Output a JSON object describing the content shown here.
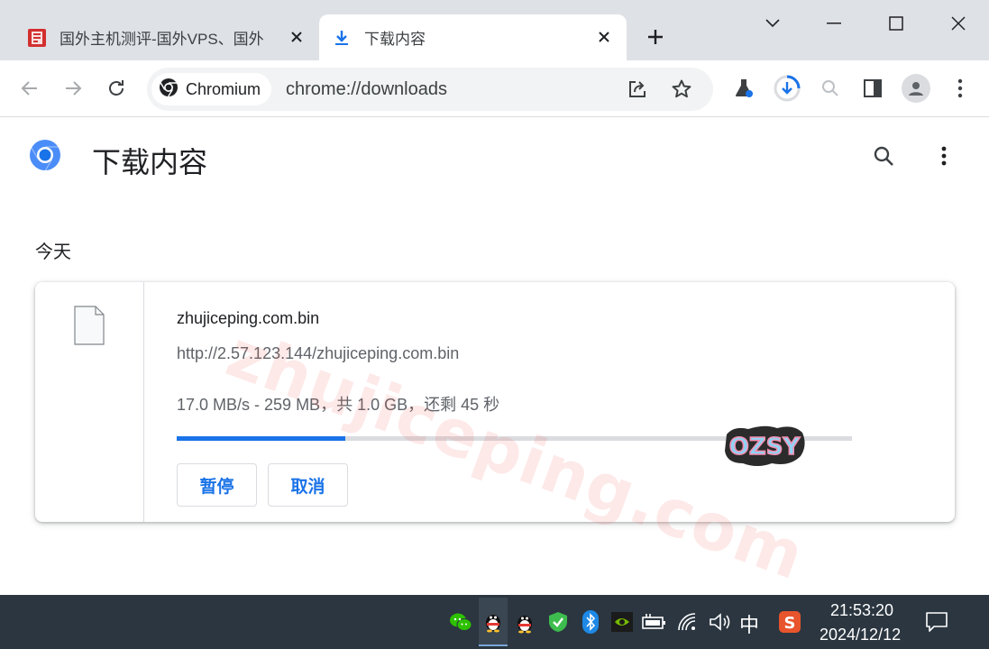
{
  "tabs": [
    {
      "title": "国外主机测评-国外VPS、国外",
      "active": false
    },
    {
      "title": "下载内容",
      "active": true
    }
  ],
  "omnibox": {
    "chip_label": "Chromium",
    "url": "chrome://downloads"
  },
  "page": {
    "title": "下载内容"
  },
  "downloads": {
    "day_label": "今天",
    "items": [
      {
        "filename": "zhujiceping.com.bin",
        "url": "http://2.57.123.144/zhujiceping.com.bin",
        "status": "17.0 MB/s - 259 MB，共 1.0 GB，还剩 45 秒",
        "progress": 0.25,
        "pause_label": "暂停",
        "cancel_label": "取消"
      }
    ]
  },
  "watermark": "zhujiceping.com",
  "sticker": "OZSY",
  "taskbar": {
    "ime": "中",
    "time": "21:53:20",
    "date": "2024/12/12"
  },
  "colors": {
    "accent": "#1a73e8",
    "tabstrip": "#dee1e6",
    "taskbar": "#2b3640"
  },
  "icons": {
    "toolbar": [
      "back-icon",
      "forward-icon",
      "reload-icon",
      "share-icon",
      "star-icon",
      "labs-icon",
      "download-icon",
      "zoom-icon",
      "side-panel-icon",
      "profile-icon",
      "menu-icon"
    ],
    "tray": [
      "wechat-icon",
      "qq-icon",
      "qq-icon",
      "security-icon",
      "bluetooth-icon",
      "nvidia-icon",
      "battery-icon",
      "wifi-icon",
      "volume-icon",
      "sogou-icon",
      "notification-icon"
    ]
  }
}
